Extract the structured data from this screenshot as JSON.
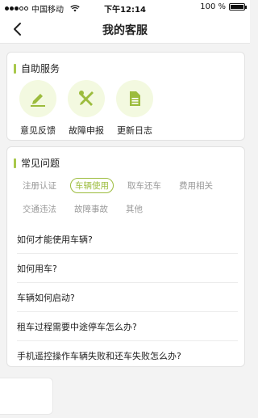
{
  "status_bar": {
    "carrier": "中国移动",
    "time": "下午12:14",
    "battery_percent": "100 %",
    "battery_level": 1.0
  },
  "nav": {
    "title": "我的客服",
    "back_icon": "chevron-left-icon"
  },
  "self_service": {
    "title": "自助服务",
    "items": [
      {
        "label": "意见反馈",
        "icon": "pen-write-icon"
      },
      {
        "label": "故障申报",
        "icon": "tools-wrench-icon"
      },
      {
        "label": "更新日志",
        "icon": "document-icon"
      }
    ]
  },
  "faq": {
    "title": "常见问题",
    "tags_row1": [
      "注册认证",
      "车辆使用",
      "取车还车",
      "费用相关"
    ],
    "tags_row2": [
      "交通违法",
      "故障事故",
      "其他"
    ],
    "active_tag": "车辆使用",
    "questions": [
      "如何才能使用车辆?",
      "如何用车?",
      "车辆如何启动?",
      "租车过程需要中途停车怎么办?",
      "手机遥控操作车辆失败和还车失败怎么办?"
    ]
  },
  "colors": {
    "accent": "#9cbc3d",
    "icon_bg": "#f3f9e0",
    "page_bg": "#f3f3f3"
  }
}
